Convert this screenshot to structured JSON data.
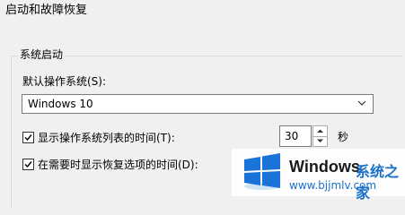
{
  "dialog": {
    "title": "启动和故障恢复"
  },
  "system_startup": {
    "group_label": "系统启动",
    "default_os_label": "默认操作系统(S):",
    "default_os_value": "Windows 10",
    "show_os_list": {
      "label": "显示操作系统列表的时间(T):",
      "checked": true,
      "value": "30",
      "unit": "秒"
    },
    "show_recovery": {
      "label": "在需要时显示恢复选项的时间(D):",
      "checked": true
    }
  },
  "watermark": {
    "brand": "Windows",
    "brand_cn": "系统之家",
    "url": "www.bjjmlv.com"
  }
}
